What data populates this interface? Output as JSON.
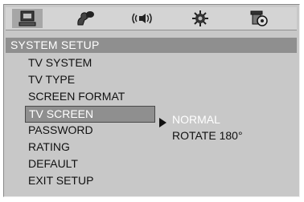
{
  "icon_bar": {
    "icons": [
      {
        "name": "system-setup-icon",
        "selected": true
      },
      {
        "name": "language-icon",
        "selected": false
      },
      {
        "name": "audio-icon",
        "selected": false
      },
      {
        "name": "video-icon",
        "selected": false
      },
      {
        "name": "speaker-icon",
        "selected": false
      }
    ]
  },
  "header": {
    "title": "SYSTEM SETUP"
  },
  "menu": {
    "items": [
      {
        "label": "TV  SYSTEM"
      },
      {
        "label": "TV TYPE"
      },
      {
        "label": "SCREEN FORMAT"
      },
      {
        "label": "TV SCREEN"
      },
      {
        "label": "PASSWORD"
      },
      {
        "label": "RATING"
      },
      {
        "label": "DEFAULT"
      },
      {
        "label": "EXIT SETUP"
      }
    ],
    "selected_index": 3
  },
  "submenu": {
    "options": [
      {
        "label": "NORMAL"
      },
      {
        "label": "ROTATE 180°"
      }
    ],
    "highlighted_index": 0
  },
  "colors": {
    "panel": "#c8c8c8",
    "highlight": "#8f8f8f",
    "text": "#111111",
    "highlight_text": "#ffffff"
  }
}
